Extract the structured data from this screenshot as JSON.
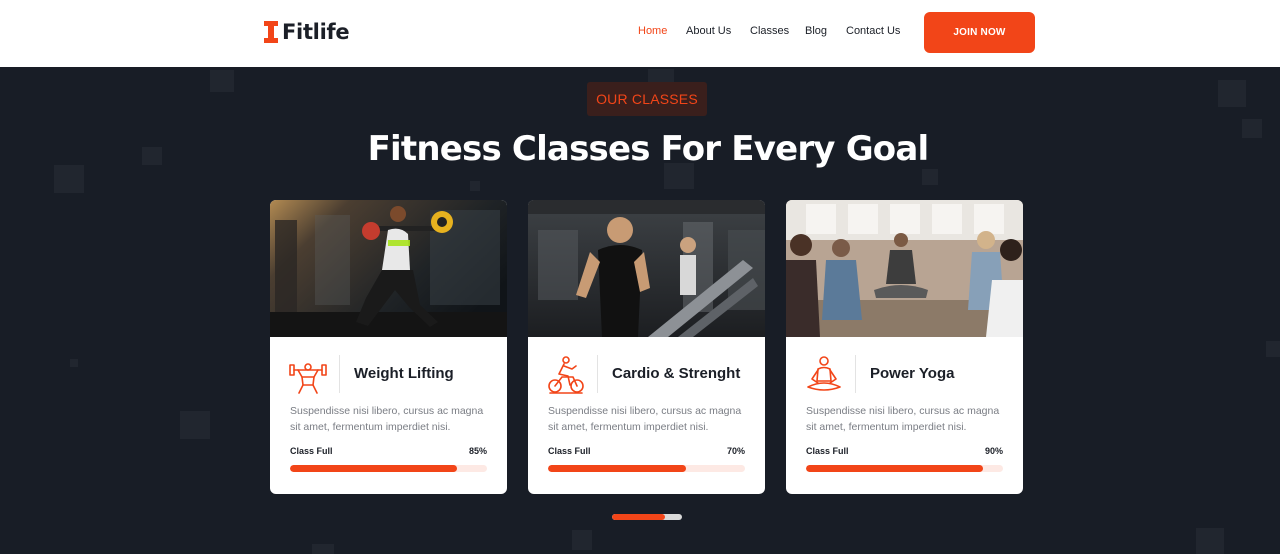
{
  "brand": {
    "name": "Fitlife",
    "accent": "#f24518",
    "dark": "#181d26"
  },
  "nav": {
    "items": [
      {
        "label": "Home",
        "active": true
      },
      {
        "label": "About Us",
        "active": false
      },
      {
        "label": "Classes",
        "active": false
      },
      {
        "label": "Blog",
        "active": false
      },
      {
        "label": "Contact Us",
        "active": false
      }
    ],
    "cta_label": "JOIN NOW"
  },
  "section": {
    "tag": "OUR CLASSES",
    "title": "Fitness Classes For Every Goal"
  },
  "cards": [
    {
      "title": "Weight Lifting",
      "icon": "weightlifter-icon",
      "image": "woman-lifting-barbell-photo",
      "description": "Suspendisse nisi libero, cursus ac magna sit amet, fermentum imperdiet nisi.",
      "progress_label": "Class Full",
      "progress_text": "85%",
      "progress": 0.85
    },
    {
      "title": "Cardio & Strenght",
      "icon": "cyclist-icon",
      "image": "man-running-treadmill-photo",
      "description": "Suspendisse nisi libero, cursus ac magna sit amet, fermentum imperdiet nisi.",
      "progress_label": "Class Full",
      "progress_text": "70%",
      "progress": 0.7
    },
    {
      "title": "Power Yoga",
      "icon": "meditation-icon",
      "image": "yoga-class-photo",
      "description": "Suspendisse nisi libero, cursus ac magna sit amet, fermentum imperdiet nisi.",
      "progress_label": "Class Full",
      "progress_text": "90%",
      "progress": 0.9
    }
  ],
  "carousel": {
    "active_index": 0,
    "progress": 0.75
  }
}
